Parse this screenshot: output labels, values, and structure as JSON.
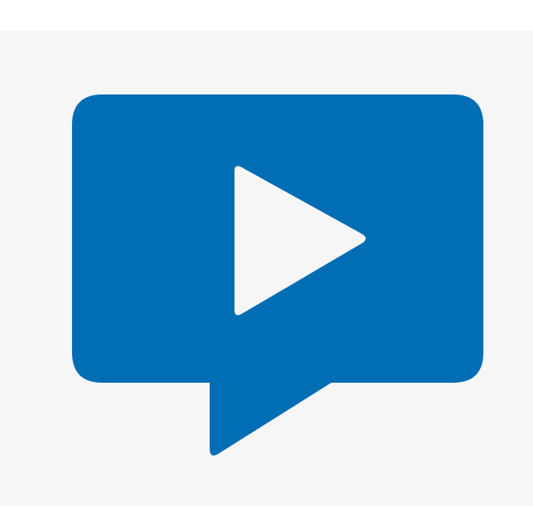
{
  "logo": {
    "icon": "video-chat-bubble-icon",
    "inner_icon": "play-icon"
  },
  "colors": {
    "page_background": "#ffffff",
    "panel_background": "#f6f6f7",
    "bubble": "#016db5",
    "play": "#f6f6f7"
  }
}
